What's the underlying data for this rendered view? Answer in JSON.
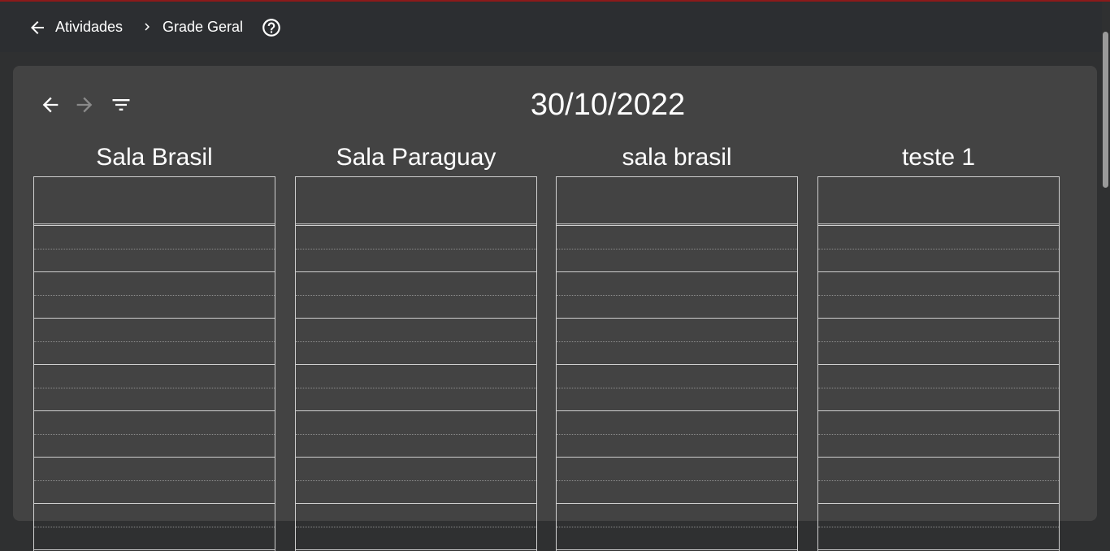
{
  "breadcrumb": {
    "parent": "Atividades",
    "current": "Grade Geral"
  },
  "icons": {
    "back": "arrow-left-icon",
    "separator": "chevron-right-icon",
    "help": "help-circle-icon",
    "prev": "arrow-left-icon",
    "next": "arrow-right-icon",
    "filter": "filter-icon"
  },
  "schedule": {
    "date": "30/10/2022",
    "rooms": [
      {
        "name": "Sala Brasil"
      },
      {
        "name": "Sala Paraguay"
      },
      {
        "name": "sala brasil"
      },
      {
        "name": "teste 1"
      }
    ]
  },
  "colors": {
    "accent": "#8b1a1a",
    "appbar": "#2c2e31",
    "card": "#434343",
    "background": "#2f3031"
  }
}
